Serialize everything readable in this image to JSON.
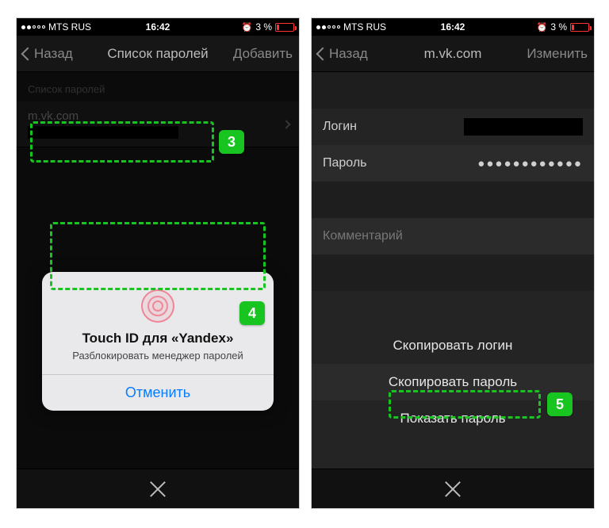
{
  "statusbar": {
    "carrier": "MTS RUS",
    "time": "16:42",
    "battery_percent": "3 %"
  },
  "left": {
    "nav": {
      "back": "Назад",
      "title": "Список паролей",
      "action": "Добавить"
    },
    "section_header": "Список паролей",
    "row_site": "m.vk.com",
    "touchid": {
      "title": "Touch ID для «Yandex»",
      "subtitle": "Разблокировать менеджер паролей",
      "cancel": "Отменить"
    }
  },
  "right": {
    "nav": {
      "back": "Назад",
      "title": "m.vk.com",
      "action": "Изменить"
    },
    "login_label": "Логин",
    "password_label": "Пароль",
    "password_mask": "●●●●●●●●●●●●",
    "comment_label": "Комментарий",
    "actions": {
      "copy_login": "Скопировать логин",
      "copy_password": "Скопировать пароль",
      "show_password": "Показать пароль"
    }
  },
  "badges": {
    "b3": "3",
    "b4": "4",
    "b5": "5"
  }
}
